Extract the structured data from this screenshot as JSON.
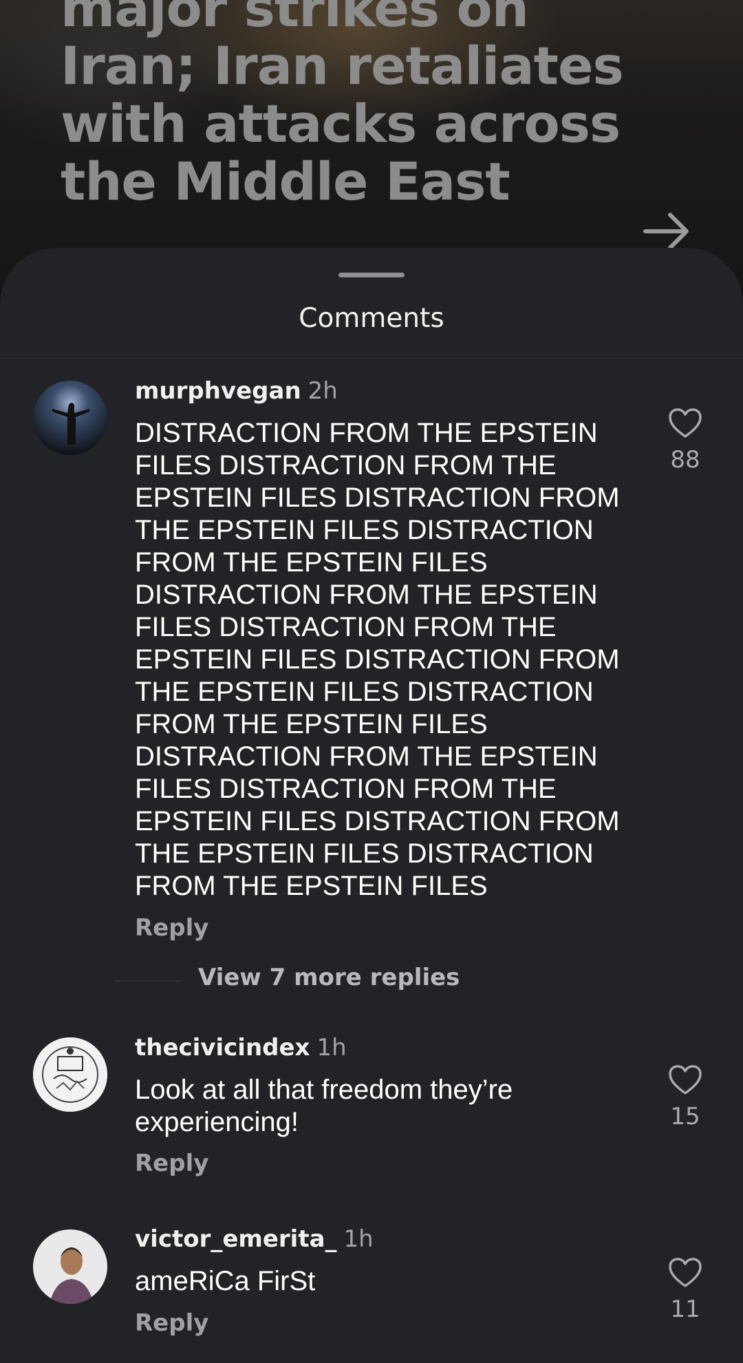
{
  "background_post": {
    "headline": "major strikes on Iran; Iran retaliates with attacks across the Middle East"
  },
  "sheet": {
    "title": "Comments"
  },
  "comments": [
    {
      "username": "murphvegan",
      "time": "2h",
      "text": "DISTRACTION FROM THE EPSTEIN FILES DISTRACTION FROM THE EPSTEIN FILES DISTRACTION FROM THE EPSTEIN FILES DISTRACTION FROM THE EPSTEIN FILES DISTRACTION FROM THE EPSTEIN FILES DISTRACTION FROM THE EPSTEIN FILES DISTRACTION FROM THE EPSTEIN FILES DISTRACTION FROM THE EPSTEIN FILES DISTRACTION FROM THE EPSTEIN FILES DISTRACTION FROM THE EPSTEIN FILES DISTRACTION FROM THE EPSTEIN FILES DISTRACTION FROM THE EPSTEIN FILES",
      "likes": "88",
      "reply_label": "Reply",
      "view_replies": "View 7 more replies"
    },
    {
      "username": "thecivicindex",
      "time": "1h",
      "text": "Look at all that freedom they’re experiencing!",
      "likes": "15",
      "reply_label": "Reply"
    },
    {
      "username": "victor_emerita_",
      "time": "1h",
      "text": "ameRiCa FirSt",
      "likes": "11",
      "reply_label": "Reply"
    }
  ],
  "icons": {
    "next": "arrow-right-icon",
    "like": "heart-outline-icon"
  },
  "colors": {
    "sheet_bg": "#222326",
    "text_primary": "#ffffff",
    "text_secondary": "#a2a4aa"
  }
}
